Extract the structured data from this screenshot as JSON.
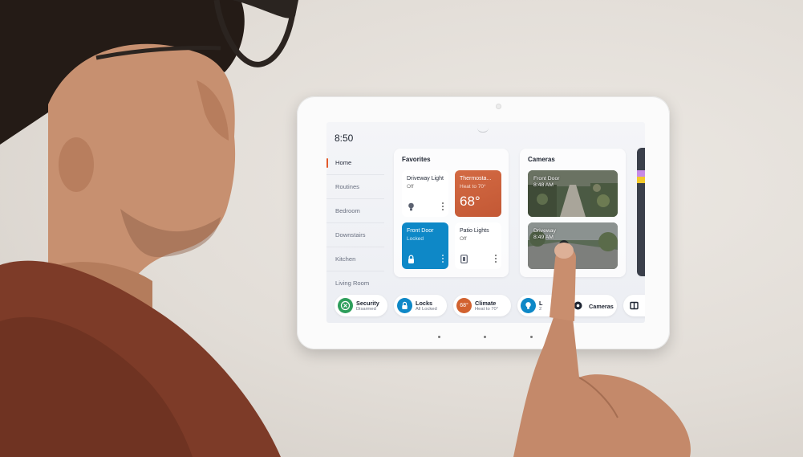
{
  "device": {
    "time": "8:50",
    "nav": [
      "Home",
      "Routines",
      "Bedroom",
      "Downstairs",
      "Kitchen",
      "Living Room"
    ],
    "active_nav": "Home",
    "favorites": {
      "title": "Favorites",
      "tiles": [
        {
          "name": "Driveway Light",
          "status": "Off"
        },
        {
          "name": "Thermosta...",
          "status": "Heat to 70°",
          "value": "68°"
        },
        {
          "name": "Front Door",
          "status": "Locked"
        },
        {
          "name": "Patio Lights",
          "status": "Off"
        }
      ]
    },
    "cameras": {
      "title": "Cameras",
      "feeds": [
        {
          "name": "Front Door",
          "time": "8:48 AM"
        },
        {
          "name": "Driveway",
          "time": "8:49 AM"
        }
      ]
    },
    "dock": [
      {
        "title": "Security",
        "sub": "Disarmed",
        "color": "#2e9e5b"
      },
      {
        "title": "Locks",
        "sub": "All Locked",
        "color": "#0e88c7"
      },
      {
        "title": "Climate",
        "sub": "Heat to 70°",
        "badge": "68°",
        "color": "#d2622f"
      },
      {
        "title": "L",
        "sub": "2",
        "color": "#0e88c7"
      },
      {
        "title": "Cameras",
        "sub": "",
        "color": "#1e2533"
      }
    ]
  },
  "colors": {
    "accent": "#e25a2c",
    "tile_blue": "#0e88c7",
    "tile_orange": "#cf643e",
    "skin": "#c98e6e",
    "shirt": "#7d3b28"
  }
}
